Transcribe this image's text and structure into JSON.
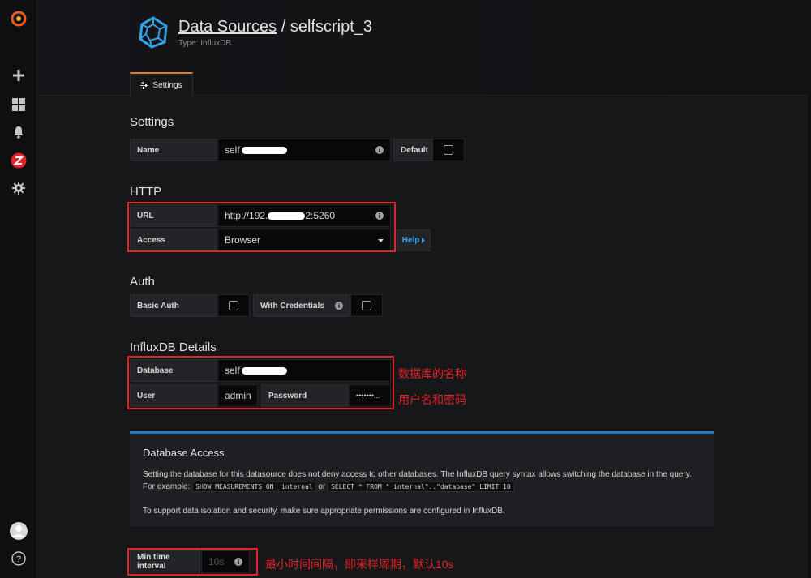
{
  "header": {
    "breadcrumb": "Data Sources",
    "separator": " / ",
    "name": "selfscript_3",
    "subtitle": "Type: InfluxDB",
    "tab_label": "Settings"
  },
  "sidebar": {
    "items": [
      "grafana-logo-icon",
      "plus-icon",
      "dashboards-icon",
      "bell-icon",
      "zabbix-icon",
      "gear-icon",
      "avatar",
      "help-icon"
    ]
  },
  "settings": {
    "title": "Settings",
    "name_label": "Name",
    "name_value": "self",
    "default_label": "Default"
  },
  "http": {
    "title": "HTTP",
    "url_label": "URL",
    "url_value_prefix": "http://192.",
    "url_value_suffix": "2:5260",
    "access_label": "Access",
    "access_value": "Browser",
    "help_label": "Help"
  },
  "auth": {
    "title": "Auth",
    "basic_label": "Basic Auth",
    "credentials_label": "With Credentials"
  },
  "influx": {
    "title": "InfluxDB Details",
    "database_label": "Database",
    "database_value": "self",
    "user_label": "User",
    "user_value": "admin",
    "password_label": "Password",
    "password_value": "•••••••..."
  },
  "db_access": {
    "title": "Database Access",
    "line1": "Setting the database for this datasource does not deny access to other databases. The InfluxDB query syntax allows switching the database in the query.",
    "line2_prefix": "For example:",
    "code1": "SHOW MEASUREMENTS ON _internal",
    "or": "or",
    "code2": "SELECT * FROM \"_internal\"..\"database\" LIMIT 10",
    "line3": "To support data isolation and security, make sure appropriate permissions are configured in InfluxDB."
  },
  "interval": {
    "label": "Min time interval",
    "placeholder": "10s"
  },
  "annotations": {
    "db_name": "数据库的名称",
    "user_pass": "用户名和密码",
    "interval": "最小时间间隔，即采样周期，默认10s"
  },
  "colors": {
    "accent_orange": "#eb7b18",
    "annotation_red": "#e3222a",
    "link_blue": "#33a2e5",
    "panel_border_blue": "#1f78c1"
  }
}
